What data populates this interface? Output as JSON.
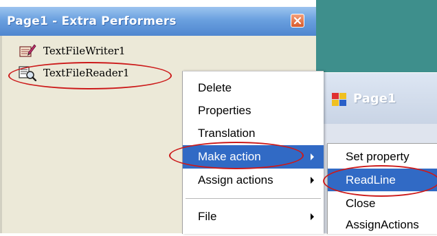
{
  "extra_performers": {
    "title": "Page1 - Extra Performers",
    "close_icon": "close-icon",
    "items": [
      {
        "label": "TextFileWriter1",
        "icon": "text-file-writer-icon"
      },
      {
        "label": "TextFileReader1",
        "icon": "text-file-reader-icon"
      }
    ]
  },
  "page1_window": {
    "title": "Page1",
    "icon": "form-icon"
  },
  "context_menu": {
    "items": [
      {
        "label": "Delete",
        "submenu": false
      },
      {
        "label": "Properties",
        "submenu": false
      },
      {
        "label": "Translation",
        "submenu": false
      },
      {
        "label": "Make action",
        "submenu": true,
        "selected": true
      },
      {
        "label": "Assign actions",
        "submenu": true
      },
      {
        "label": "File",
        "submenu": true
      }
    ]
  },
  "submenu": {
    "items": [
      {
        "label": "Set property"
      },
      {
        "label": "ReadLine",
        "selected": true
      },
      {
        "label": "Close"
      },
      {
        "label": "AssignActions"
      }
    ]
  },
  "colors": {
    "highlight": "#316ac5",
    "annotation_ring": "#cc1a1a",
    "desktop_teal": "#3e8f8c"
  }
}
